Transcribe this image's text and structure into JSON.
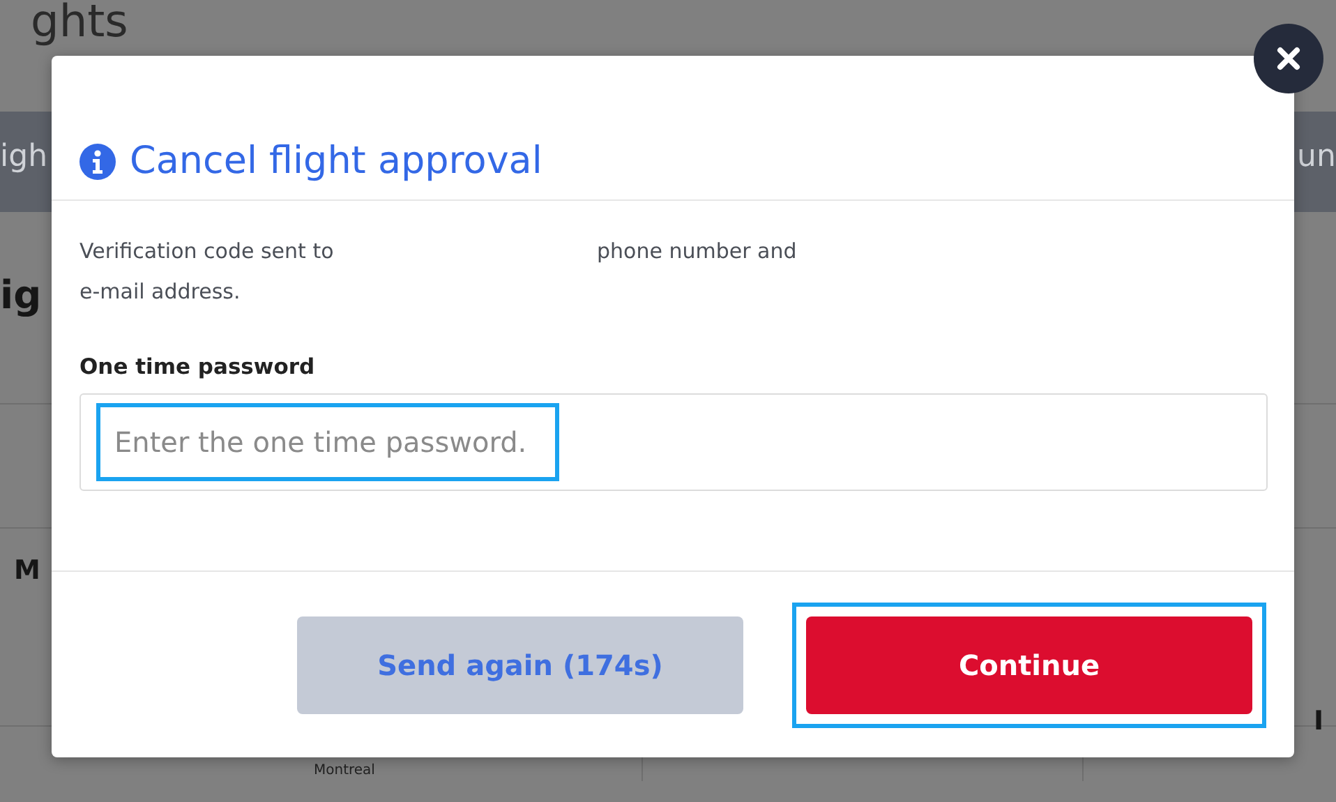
{
  "background_page": {
    "texts": [
      {
        "kind": "heading",
        "text": "ghts"
      },
      {
        "kind": "band",
        "text": "igh"
      },
      {
        "kind": "band-right",
        "text": "un"
      },
      {
        "kind": "subheading",
        "text": "ig"
      },
      {
        "kind": "column",
        "text": "M"
      },
      {
        "kind": "column-right",
        "text": "I"
      },
      {
        "kind": "city",
        "text": "Montreal"
      }
    ]
  },
  "dialog": {
    "title": "Cancel flight approval",
    "message_lines": [
      {
        "text": "Verification code sent to"
      },
      {
        "text": "phone number and"
      },
      {
        "text": "e-mail address."
      }
    ],
    "field": {
      "label": "One time password",
      "placeholder": "Enter the one time password.",
      "highlighted": true
    },
    "buttons": [
      {
        "kind": "secondary",
        "label": "Send again (174s)",
        "disabled": true,
        "highlighted": false
      },
      {
        "kind": "primary",
        "label": "Continue",
        "disabled": false,
        "highlighted": true
      }
    ]
  }
}
